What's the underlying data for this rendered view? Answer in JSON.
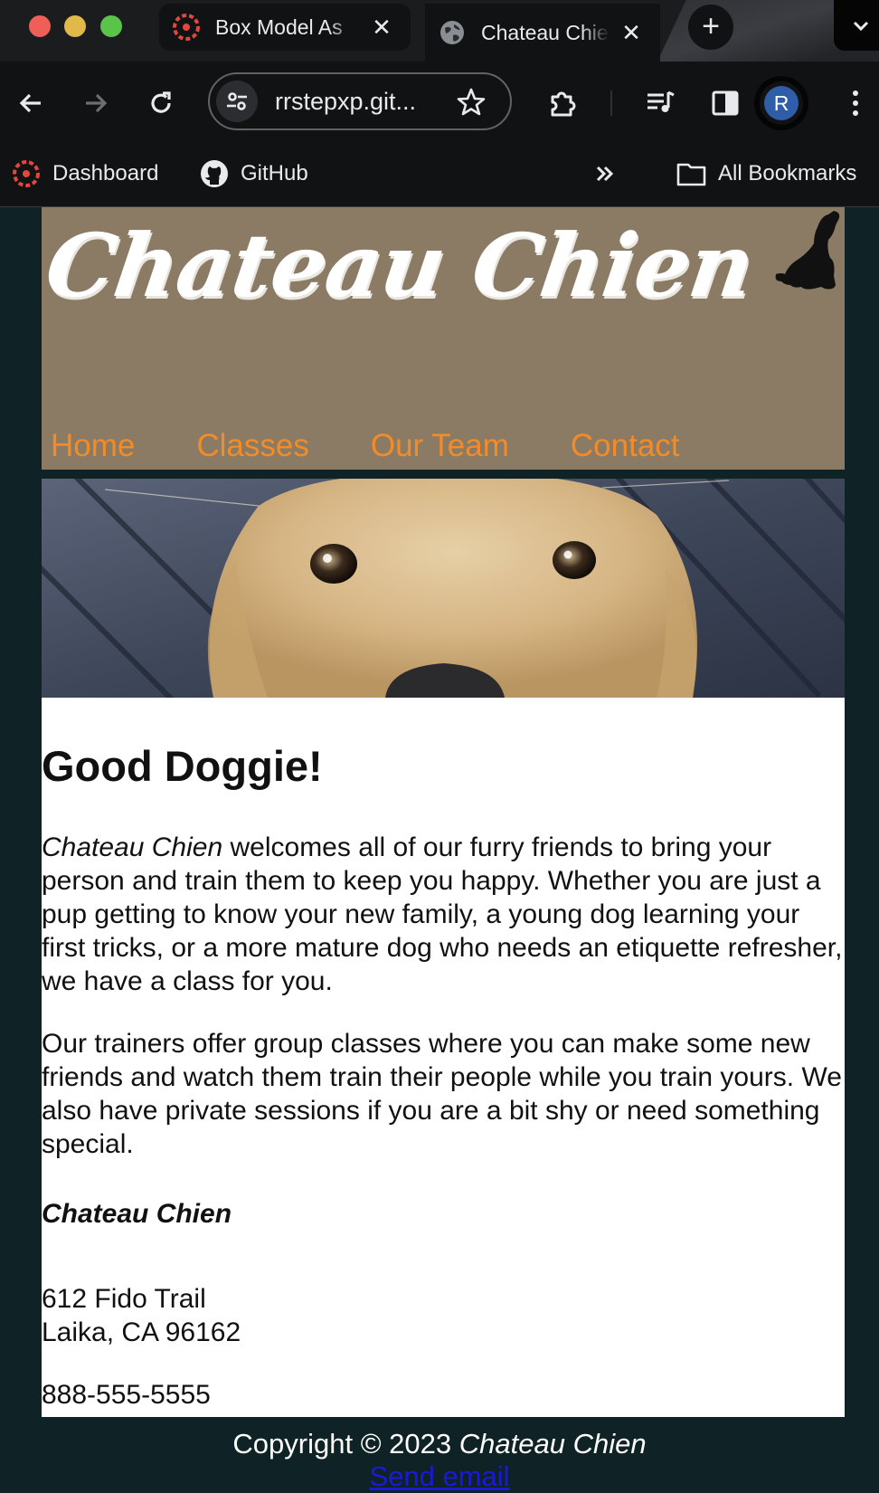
{
  "browser": {
    "tabs": [
      {
        "title": "Box Model As",
        "favicon": "canvas-logo-icon"
      },
      {
        "title": "Chateau Chie",
        "favicon": "globe-icon"
      }
    ],
    "address": "rrstepxp.git...",
    "profile_initial": "R",
    "bookmarks": [
      {
        "label": "Dashboard",
        "icon": "canvas-logo-icon"
      },
      {
        "label": "GitHub",
        "icon": "github-icon"
      }
    ],
    "all_bookmarks_label": "All Bookmarks"
  },
  "site": {
    "title": "Chateau Chien",
    "nav": [
      "Home",
      "Classes",
      "Our Team",
      "Contact"
    ],
    "heading": "Good Doggie!",
    "intro_brand": "Chateau Chien",
    "intro_rest": " welcomes all of our furry friends to bring your person and train them to keep you happy. Whether you are just a pup getting to know your new family, a young dog learning your first tricks, or a more mature dog who needs an etiquette refresher, we have a class for you.",
    "paragraph2": "Our trainers offer group classes where you can make some new friends and watch them train their people while you train yours. We also have private sessions if you are a bit shy or need something special.",
    "contact_name": "Chateau Chien",
    "street": "612 Fido Trail",
    "city": "Laika, CA 96162",
    "phone": "888-555-5555",
    "footer_prefix": "Copyright © 2023 ",
    "footer_brand": "Chateau Chien",
    "footer_email": "Send email"
  },
  "colors": {
    "page_bg": "#0f2327",
    "header_bg": "#8c7b64",
    "nav_link": "#f28c28",
    "content_bg": "#ffffff"
  }
}
